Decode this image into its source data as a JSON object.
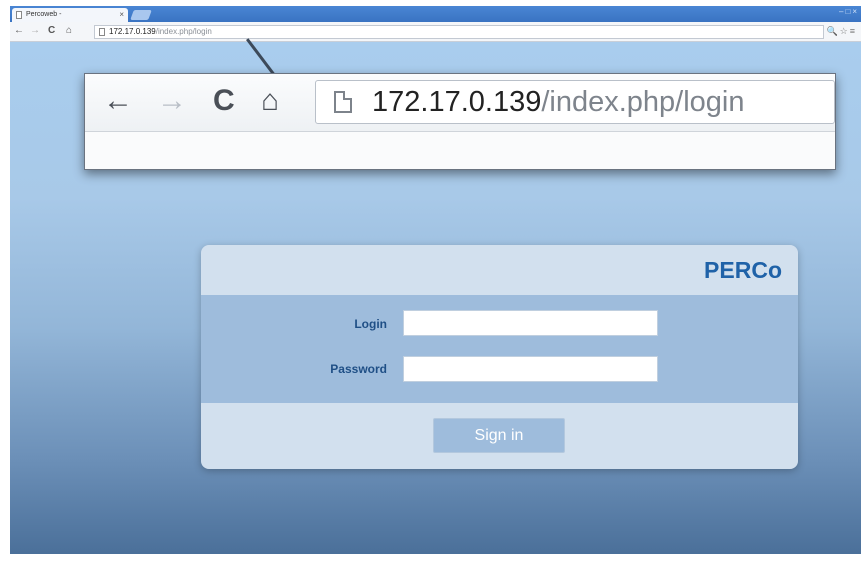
{
  "browser": {
    "tab_title": "Percoweb -",
    "tab_close": "×",
    "window_controls": "–□×",
    "nav": {
      "back": "←",
      "forward": "→",
      "reload": "C",
      "home": "⌂"
    },
    "url_host": "172.17.0.139",
    "url_path": "/index.php/login",
    "right_icons": "🔍☆≡"
  },
  "callout": {
    "back": "←",
    "forward": "→",
    "reload": "C",
    "home": "⌂",
    "url_host": "172.17.0.139",
    "url_path": "/index.php/login"
  },
  "login": {
    "brand": "PERCo",
    "login_label": "Login",
    "login_value": "",
    "password_label": "Password",
    "password_value": "",
    "submit_label": "Sign in"
  },
  "colors": {
    "brand": "#1f62a8",
    "label": "#1f4f86",
    "panel_light": "#d2e0ee",
    "panel_mid": "#9ebcdc"
  }
}
